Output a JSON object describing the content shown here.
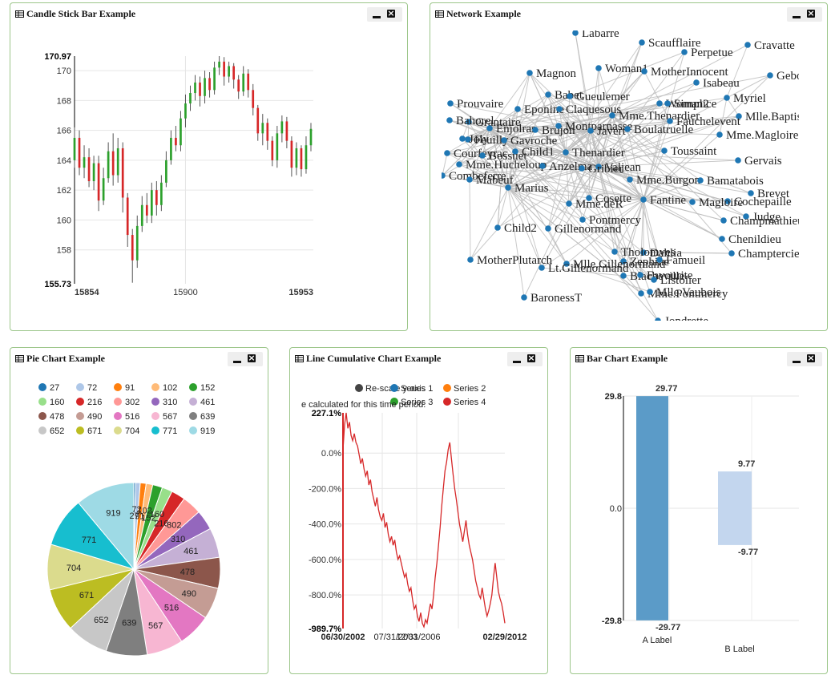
{
  "colors": {
    "panel_border": "#9cc68a",
    "candle_up": "#2ca02c",
    "candle_down": "#d62728",
    "node": "#1f77b4",
    "line": "#d62728",
    "bar_a": "#5b9bc8",
    "bar_b": "#c3d6ee",
    "palette": [
      "#1f77b4",
      "#aec7e8",
      "#ff7f0e",
      "#ffbb78",
      "#2ca02c",
      "#98df8a",
      "#d62728",
      "#ff9896",
      "#9467bd",
      "#c5b0d5",
      "#8c564b",
      "#c49c94",
      "#e377c2",
      "#f7b6d2",
      "#7f7f7f",
      "#c7c7c7",
      "#bcbd22",
      "#dbdb8d",
      "#17becf",
      "#9edae5"
    ]
  },
  "panels": {
    "candle": {
      "title": "Candle Stick Bar Example"
    },
    "network": {
      "title": "Network Example"
    },
    "pie": {
      "title": "Pie Chart Example"
    },
    "line": {
      "title": "Line Cumulative Chart Example"
    },
    "bar": {
      "title": "Bar Chart Example"
    }
  },
  "buttons": {
    "close_glyph": "×"
  },
  "icons": {
    "title_icon": "table-icon",
    "minimize": "minimize-icon",
    "close": "close-icon"
  },
  "network": {
    "nodes": [
      "Labarre",
      "Scaufflaire",
      "Perpetue",
      "Cravatte",
      "Magnon",
      "Woman1",
      "MotherInnocent",
      "Geborand",
      "Isabeau",
      "Babet",
      "Gueulemer",
      "Woman2",
      "Simplice",
      "Myriel",
      "Mlle.Baptistine",
      "Prouvaire",
      "Eponine",
      "Claquesous",
      "Mme.Thenardier",
      "Fauchelevent",
      "Grantaire",
      "Feuilly",
      "Enjolras",
      "Brujon",
      "Montparnasse",
      "Javert",
      "Boulatruelle",
      "Mme.Magloire",
      "Joly",
      "Gavroche",
      "Child1",
      "Thenardier",
      "Mme.Hucheloup",
      "Anzelma",
      "Valjean",
      "Toussaint",
      "Gervais",
      "Courfeyrac",
      "Bossuet",
      "Combeferre",
      "Mabeuf",
      "Gribier",
      "Mme.Burgon",
      "Bamatabois",
      "Marius",
      "Brevet",
      "Cosette",
      "Fantine",
      "Mme.deR",
      "Cochepaille",
      "Judge",
      "Pontmercy",
      "Magloire",
      "Champmathieu",
      "Child2",
      "Gillenormand",
      "Chenildieu",
      "Dahlia",
      "Champtercier",
      "Tholomyes",
      "Zephine",
      "MotherPlutarch",
      "Mlle.Gillenormand",
      "Famueil",
      "Lt.Gillenormand",
      "Blacheville",
      "Favourite",
      "Listolier",
      "BaronessT",
      "Mme.Pontmercy",
      "Mlle.Vaubois",
      "Jondrette",
      "Bahorel"
    ]
  },
  "chart_data": [
    {
      "type": "candlestick",
      "title": "Candle Stick Bar Example",
      "xlim": [
        15854,
        15953
      ],
      "ylim": [
        155.73,
        170.97
      ],
      "x_ticks": [
        15854,
        15900,
        15953
      ],
      "y_ticks": [
        158,
        160,
        162,
        164,
        166,
        168,
        170
      ],
      "y_extremes": [
        "170.97",
        "155.73"
      ],
      "series": [
        {
          "x": 15854,
          "open": 164,
          "close": 165.5,
          "high": 166.2,
          "low": 163.5
        },
        {
          "x": 15856,
          "open": 165.5,
          "close": 163.5,
          "high": 166,
          "low": 163
        },
        {
          "x": 15858,
          "open": 163.5,
          "close": 164.2,
          "high": 165,
          "low": 162.8
        },
        {
          "x": 15860,
          "open": 164.2,
          "close": 162.6,
          "high": 164.8,
          "low": 162.2
        },
        {
          "x": 15862,
          "open": 162.6,
          "close": 163.8,
          "high": 164.3,
          "low": 162
        },
        {
          "x": 15864,
          "open": 163.8,
          "close": 161.3,
          "high": 164.3,
          "low": 160.6
        },
        {
          "x": 15866,
          "open": 161.3,
          "close": 162.8,
          "high": 163.5,
          "low": 161
        },
        {
          "x": 15868,
          "open": 162.8,
          "close": 164.6,
          "high": 165.2,
          "low": 162.5
        },
        {
          "x": 15870,
          "open": 164.6,
          "close": 163,
          "high": 165.8,
          "low": 162.3
        },
        {
          "x": 15872,
          "open": 163,
          "close": 164.8,
          "high": 165.5,
          "low": 162.5
        },
        {
          "x": 15874,
          "open": 164.8,
          "close": 161.5,
          "high": 165.2,
          "low": 160.5
        },
        {
          "x": 15876,
          "open": 161.5,
          "close": 159,
          "high": 161.8,
          "low": 158.2
        },
        {
          "x": 15878,
          "open": 159,
          "close": 157.3,
          "high": 159.4,
          "low": 155.8
        },
        {
          "x": 15880,
          "open": 157.3,
          "close": 159.6,
          "high": 160.3,
          "low": 156.8
        },
        {
          "x": 15882,
          "open": 159.6,
          "close": 161,
          "high": 161.6,
          "low": 159.2
        },
        {
          "x": 15884,
          "open": 161,
          "close": 160.3,
          "high": 161.8,
          "low": 159.8
        },
        {
          "x": 15886,
          "open": 160.3,
          "close": 162,
          "high": 162.5,
          "low": 159.8
        },
        {
          "x": 15888,
          "open": 162,
          "close": 161,
          "high": 162.6,
          "low": 160.3
        },
        {
          "x": 15890,
          "open": 161,
          "close": 162.5,
          "high": 163,
          "low": 160.6
        },
        {
          "x": 15892,
          "open": 162.5,
          "close": 164,
          "high": 164.6,
          "low": 162.2
        },
        {
          "x": 15894,
          "open": 164,
          "close": 165.5,
          "high": 166,
          "low": 163.7
        },
        {
          "x": 15896,
          "open": 165.5,
          "close": 165,
          "high": 166.3,
          "low": 164.6
        },
        {
          "x": 15898,
          "open": 165,
          "close": 166.8,
          "high": 167.3,
          "low": 164.6
        },
        {
          "x": 15900,
          "open": 166.8,
          "close": 167.8,
          "high": 168.4,
          "low": 166.2
        },
        {
          "x": 15902,
          "open": 167.8,
          "close": 168.5,
          "high": 169,
          "low": 167.3
        },
        {
          "x": 15904,
          "open": 168.5,
          "close": 169.2,
          "high": 169.7,
          "low": 168
        },
        {
          "x": 15906,
          "open": 169.2,
          "close": 168.3,
          "high": 169.6,
          "low": 167.6
        },
        {
          "x": 15908,
          "open": 168.3,
          "close": 169.5,
          "high": 170,
          "low": 167.8
        },
        {
          "x": 15910,
          "open": 169.5,
          "close": 168.7,
          "high": 169.9,
          "low": 168.2
        },
        {
          "x": 15912,
          "open": 168.7,
          "close": 170.2,
          "high": 170.6,
          "low": 168.4
        },
        {
          "x": 15914,
          "open": 170.2,
          "close": 170.6,
          "high": 170.97,
          "low": 169.7
        },
        {
          "x": 15916,
          "open": 170.6,
          "close": 169.6,
          "high": 170.9,
          "low": 169
        },
        {
          "x": 15918,
          "open": 169.6,
          "close": 170.3,
          "high": 170.6,
          "low": 169.2
        },
        {
          "x": 15920,
          "open": 170.3,
          "close": 169.4,
          "high": 170.5,
          "low": 168.8
        },
        {
          "x": 15922,
          "open": 169.4,
          "close": 168.6,
          "high": 169.7,
          "low": 168.1
        },
        {
          "x": 15924,
          "open": 168.6,
          "close": 169.8,
          "high": 170.3,
          "low": 168.3
        },
        {
          "x": 15926,
          "open": 169.8,
          "close": 168.7,
          "high": 170.1,
          "low": 168.2
        },
        {
          "x": 15928,
          "open": 168.7,
          "close": 167.5,
          "high": 169.1,
          "low": 167
        },
        {
          "x": 15930,
          "open": 167.5,
          "close": 165.8,
          "high": 167.7,
          "low": 165.3
        },
        {
          "x": 15932,
          "open": 165.8,
          "close": 166.5,
          "high": 167.1,
          "low": 165
        },
        {
          "x": 15934,
          "open": 166.5,
          "close": 165.3,
          "high": 166.8,
          "low": 164.7
        },
        {
          "x": 15936,
          "open": 165.3,
          "close": 164,
          "high": 165.6,
          "low": 163.6
        },
        {
          "x": 15938,
          "open": 164,
          "close": 165.8,
          "high": 166.3,
          "low": 163.5
        },
        {
          "x": 15940,
          "open": 165.8,
          "close": 166.6,
          "high": 167,
          "low": 165.2
        },
        {
          "x": 15942,
          "open": 166.6,
          "close": 165.3,
          "high": 166.9,
          "low": 164.8
        },
        {
          "x": 15944,
          "open": 165.3,
          "close": 163.5,
          "high": 165.6,
          "low": 162.9
        },
        {
          "x": 15946,
          "open": 163.5,
          "close": 164.8,
          "high": 165.2,
          "low": 163
        },
        {
          "x": 15948,
          "open": 164.8,
          "close": 163.4,
          "high": 165,
          "low": 162.9
        },
        {
          "x": 15950,
          "open": 163.4,
          "close": 165,
          "high": 165.6,
          "low": 163.1
        },
        {
          "x": 15952,
          "open": 165,
          "close": 166.1,
          "high": 166.5,
          "low": 164.6
        }
      ]
    },
    {
      "type": "pie",
      "title": "Pie Chart Example",
      "labels": [
        "27",
        "72",
        "91",
        "102",
        "152",
        "160",
        "216",
        "302",
        "310",
        "461",
        "478",
        "490",
        "516",
        "567",
        "639",
        "652",
        "671",
        "704",
        "771",
        "919"
      ],
      "values": [
        27,
        72,
        91,
        102,
        152,
        160,
        216,
        302,
        310,
        461,
        478,
        490,
        516,
        567,
        639,
        652,
        671,
        704,
        771,
        919
      ],
      "legend": "top"
    },
    {
      "type": "line",
      "title": "Line Cumulative Chart Example",
      "legend_items": [
        "Re-scale y-axis",
        "Series 1",
        "Series 2",
        "Series 3",
        "Series 4"
      ],
      "note": "e calculated for this time period.",
      "x_labels": [
        "06/30/2002",
        "07/31/2003",
        "12/31/2006",
        "02/29/2012"
      ],
      "y_ticks": [
        "0.0%",
        "-200.0%",
        "-400.0%",
        "-600.0%",
        "-800.0%"
      ],
      "y_extremes": [
        "227.1%",
        "-989.7%"
      ],
      "ylim": [
        -989.7,
        227.1
      ],
      "series": [
        {
          "name": "Series 4",
          "x": [
            0,
            1,
            2,
            3,
            4,
            5,
            6,
            7,
            8,
            9,
            10,
            11,
            12,
            13,
            14,
            15,
            16,
            17,
            18,
            19,
            20,
            21,
            22,
            23,
            24,
            25,
            26,
            27,
            28,
            29,
            30,
            31,
            32,
            33,
            34,
            35,
            36,
            37,
            38,
            39,
            40,
            41,
            42,
            43,
            44,
            45,
            46,
            47,
            48,
            49,
            50,
            51,
            52,
            53,
            54,
            55,
            56,
            57,
            58,
            59,
            60,
            61,
            62,
            63,
            64,
            65,
            66,
            67,
            68,
            69,
            70,
            71,
            72,
            73,
            74,
            75,
            76,
            77,
            78,
            79,
            80,
            81,
            82,
            83,
            84,
            85,
            86,
            87,
            88,
            89,
            90,
            91,
            92,
            93,
            94,
            95,
            96,
            97,
            98,
            99,
            100
          ],
          "y": [
            20,
            160,
            227,
            140,
            175,
            100,
            70,
            110,
            60,
            40,
            -10,
            -60,
            -30,
            -90,
            -130,
            -100,
            -180,
            -150,
            -220,
            -260,
            -300,
            -250,
            -320,
            -360,
            -380,
            -340,
            -420,
            -390,
            -460,
            -500,
            -470,
            -520,
            -490,
            -560,
            -600,
            -580,
            -620,
            -660,
            -700,
            -680,
            -740,
            -780,
            -760,
            -830,
            -880,
            -860,
            -920,
            -950,
            -900,
            -960,
            -980,
            -940,
            -960,
            -900,
            -850,
            -880,
            -800,
            -700,
            -620,
            -520,
            -420,
            -300,
            -200,
            -100,
            -50,
            20,
            60,
            -30,
            -120,
            -200,
            -260,
            -330,
            -400,
            -450,
            -500,
            -440,
            -380,
            -460,
            -520,
            -560,
            -600,
            -660,
            -720,
            -760,
            -800,
            -820,
            -760,
            -820,
            -880,
            -920,
            -890,
            -850,
            -800,
            -700,
            -620,
            -700,
            -780,
            -820,
            -850,
            -900,
            -960
          ]
        }
      ]
    },
    {
      "type": "bar",
      "title": "Bar Chart Example",
      "categories": [
        "A Label",
        "B Label"
      ],
      "series": [
        {
          "values": [
            29.77,
            -29.77
          ]
        },
        {
          "values": [
            9.77,
            -9.77
          ]
        }
      ],
      "value_labels": [
        "29.77",
        "-29.77",
        "9.77",
        "-9.77"
      ],
      "y_ticks": [
        "29.8",
        "0.0",
        "-29.8"
      ],
      "ylim": [
        -29.8,
        29.8
      ]
    }
  ]
}
